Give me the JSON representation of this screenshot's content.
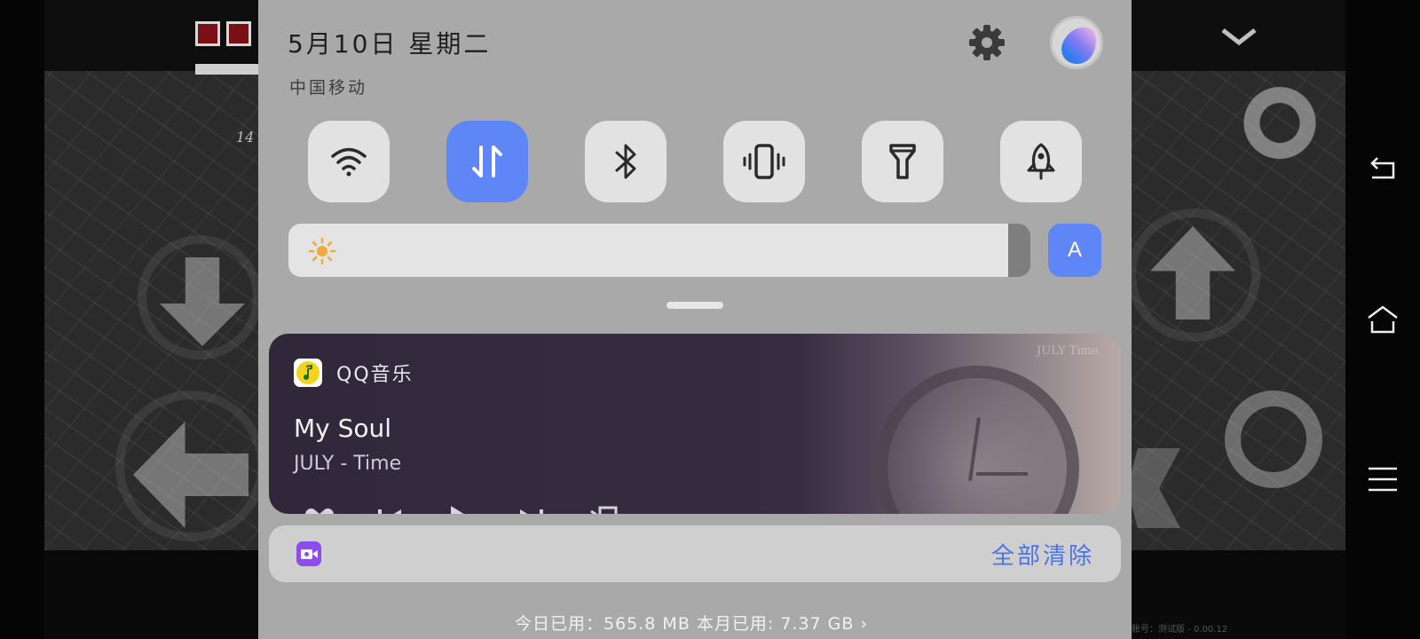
{
  "status": {
    "date": "5月10日 星期二",
    "carrier": "中国移动"
  },
  "header_icons": {
    "settings": "gear-icon",
    "account": "avatar"
  },
  "quick_toggles": [
    {
      "name": "wifi",
      "icon": "wifi-icon",
      "active": false
    },
    {
      "name": "mobile-data",
      "icon": "data-arrows-icon",
      "active": true
    },
    {
      "name": "bluetooth",
      "icon": "bluetooth-icon",
      "active": false
    },
    {
      "name": "vibrate",
      "icon": "vibrate-icon",
      "active": false
    },
    {
      "name": "flashlight",
      "icon": "flashlight-icon",
      "active": false
    },
    {
      "name": "game-mode",
      "icon": "rocket-icon",
      "active": false
    }
  ],
  "brightness": {
    "level": 0.97,
    "auto_label": "A"
  },
  "music": {
    "app_name": "QQ音乐",
    "song_title": "My Soul",
    "artist": "JULY - Time",
    "album_watermark": "JULY Time",
    "controls": [
      "heart-icon",
      "previous-icon",
      "play-icon",
      "next-icon",
      "lyrics-icon"
    ]
  },
  "notification": {
    "clear_all": "全部清除"
  },
  "data_usage": "今日已用：565.8 MB 本月已用: 7.37 GB ›",
  "game": {
    "counter": "14",
    "version": "账号：测试版 - 0.00.12"
  },
  "colors": {
    "accent": "#5f86f7",
    "shade_bg": "#a9a9a9",
    "music_card": "#30283a",
    "clear_text": "#4d73e6"
  }
}
